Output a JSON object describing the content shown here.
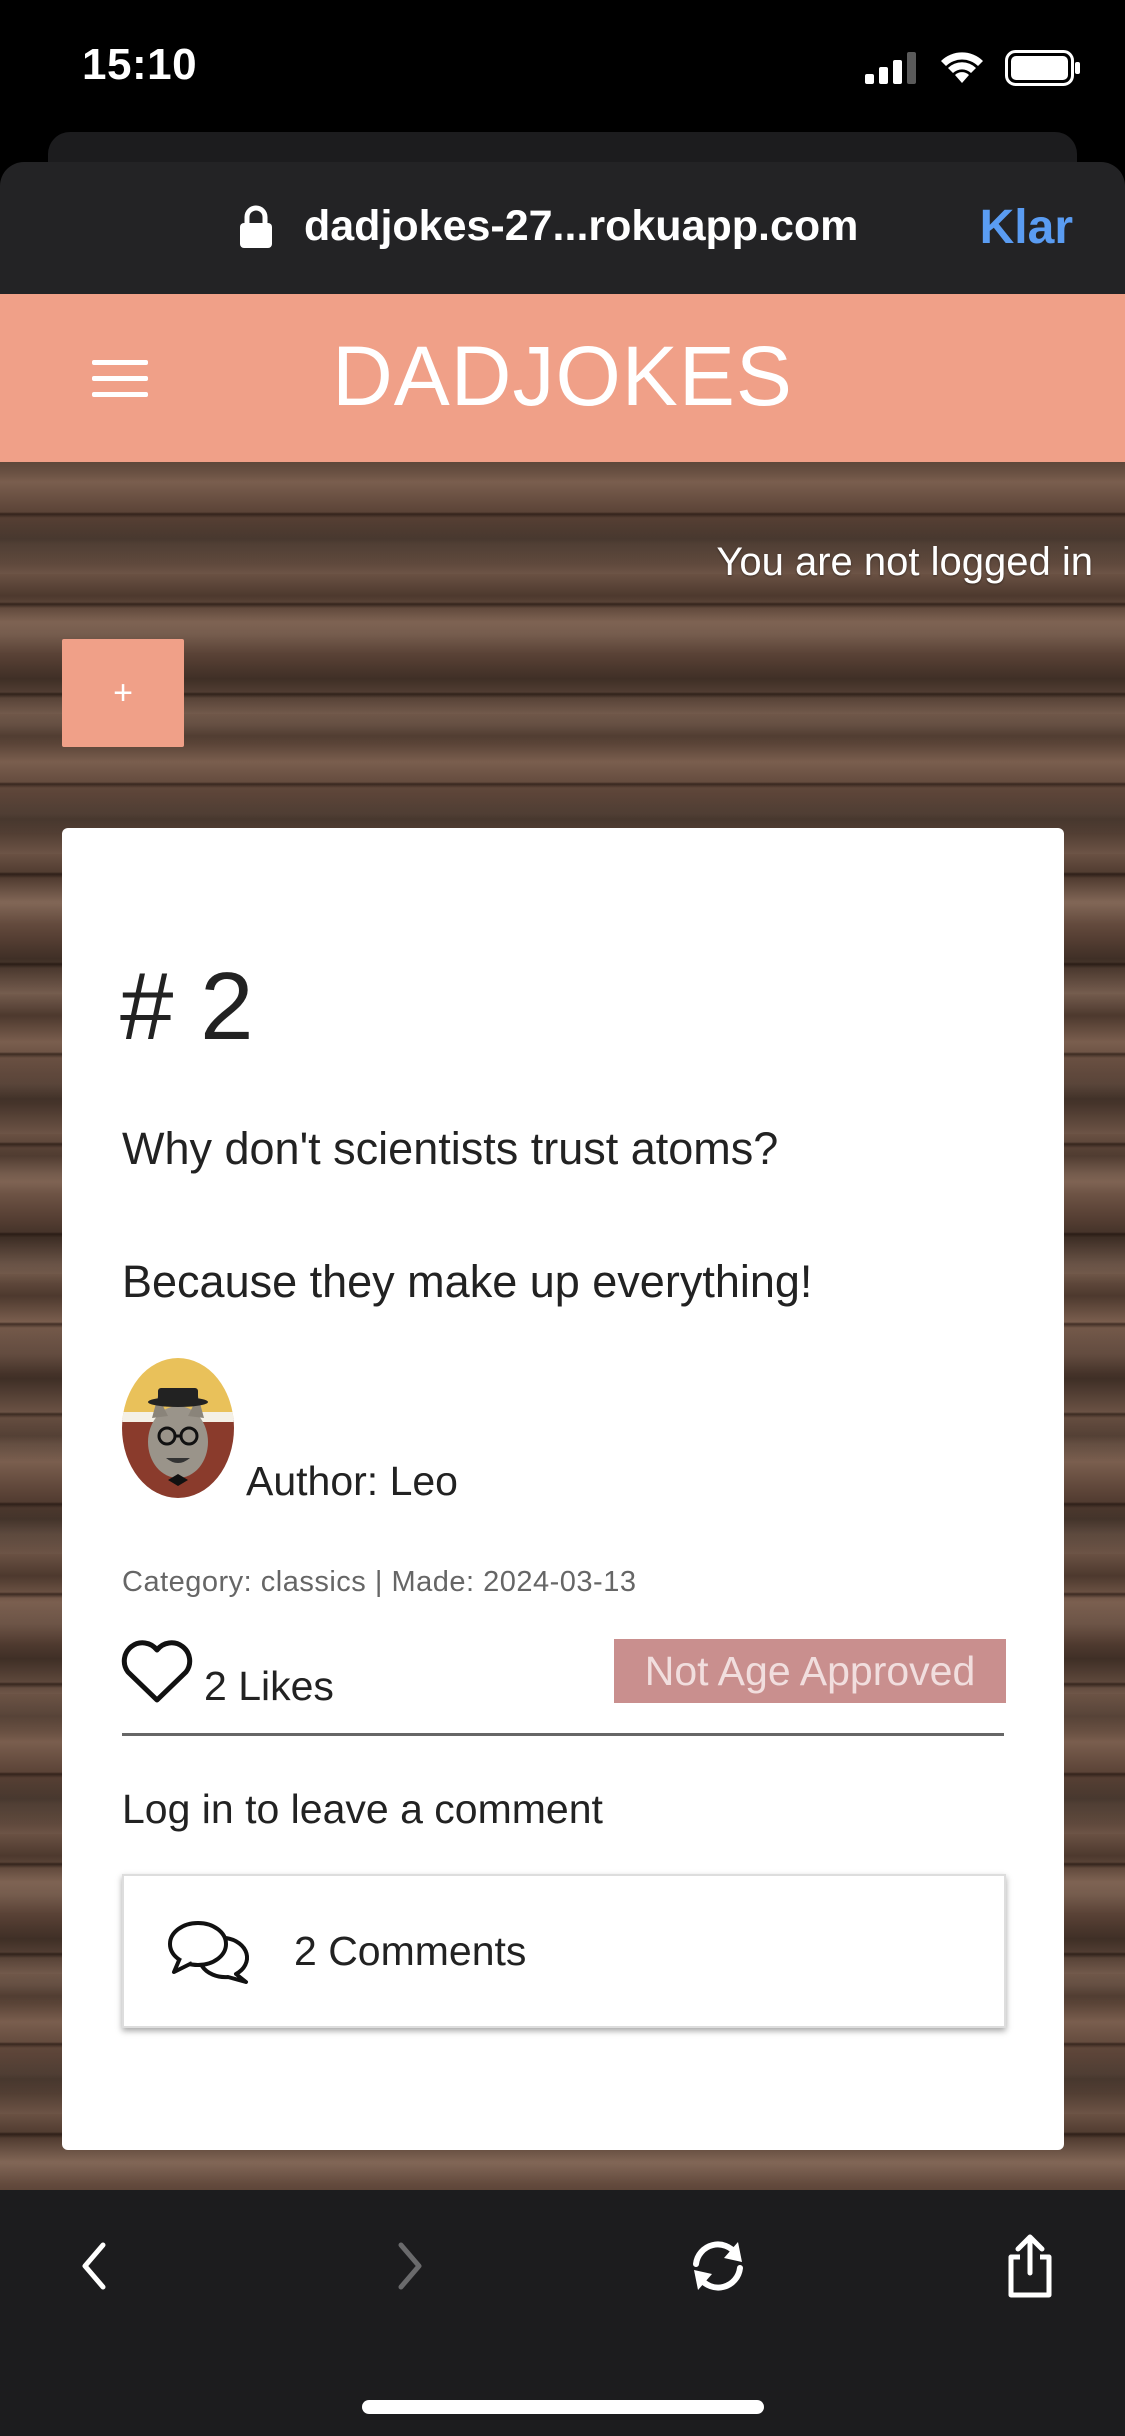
{
  "status_bar": {
    "time": "15:10"
  },
  "browser": {
    "url": "dadjokes-27...rokuapp.com",
    "done_label": "Klar"
  },
  "nav": {
    "brand": "DADJOKES"
  },
  "auth": {
    "status": "You are not logged in"
  },
  "add_button": {
    "label": "+"
  },
  "joke": {
    "number": "# 2",
    "setup": "Why don't scientists trust atoms?",
    "punchline": "Because they make up everything!",
    "author": "Author: Leo",
    "meta": "Category: classics | Made: 2024-03-13",
    "likes": "2 Likes",
    "age_badge": "Not Age Approved",
    "login_prompt": "Log in to leave a comment",
    "comments": "2 Comments"
  },
  "colors": {
    "accent": "#f0a088",
    "badge": "#c98f8e",
    "link": "#5a9cf2"
  },
  "icons": [
    "signal-icon",
    "wifi-icon",
    "battery-icon",
    "lock-icon",
    "menu-icon",
    "heart-icon",
    "comments-icon",
    "back-icon",
    "forward-icon",
    "reload-icon",
    "share-icon"
  ]
}
